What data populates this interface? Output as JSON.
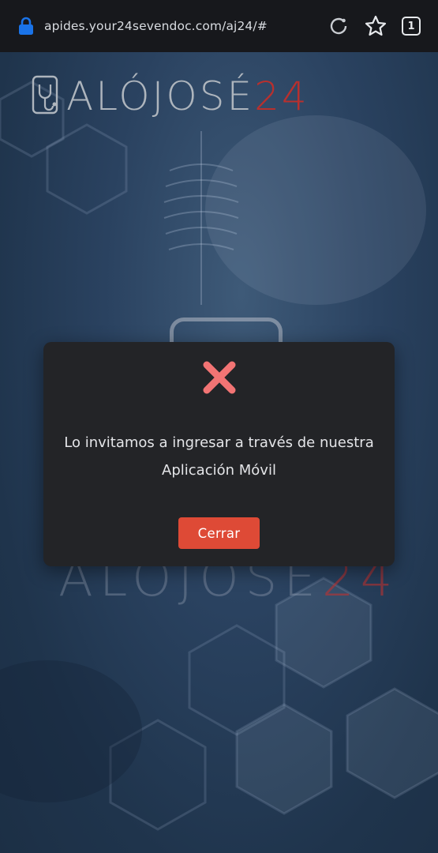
{
  "browser": {
    "url": "apides.your24sevendoc.com/aj24/#",
    "tab_count": "1",
    "icons": [
      "lock-icon",
      "refresh-icon",
      "star-icon",
      "tab-count"
    ]
  },
  "brand": {
    "logo_main": "ALÓJOSÉ",
    "logo_number": "24",
    "logo_icon": "medical-phone-stethoscope-icon"
  },
  "modal": {
    "icon": "error-x-icon",
    "message_line1": "Lo invitamos a ingresar a través de nuestra",
    "message_line2": "Aplicación Móvil",
    "close_label": "Cerrar"
  },
  "colors": {
    "topbar": "#17181c",
    "lock": "#1a73e8",
    "modal_bg": "#232427",
    "error_x": "#f27474",
    "button": "#de4a36",
    "brand_red": "#b8302e"
  }
}
